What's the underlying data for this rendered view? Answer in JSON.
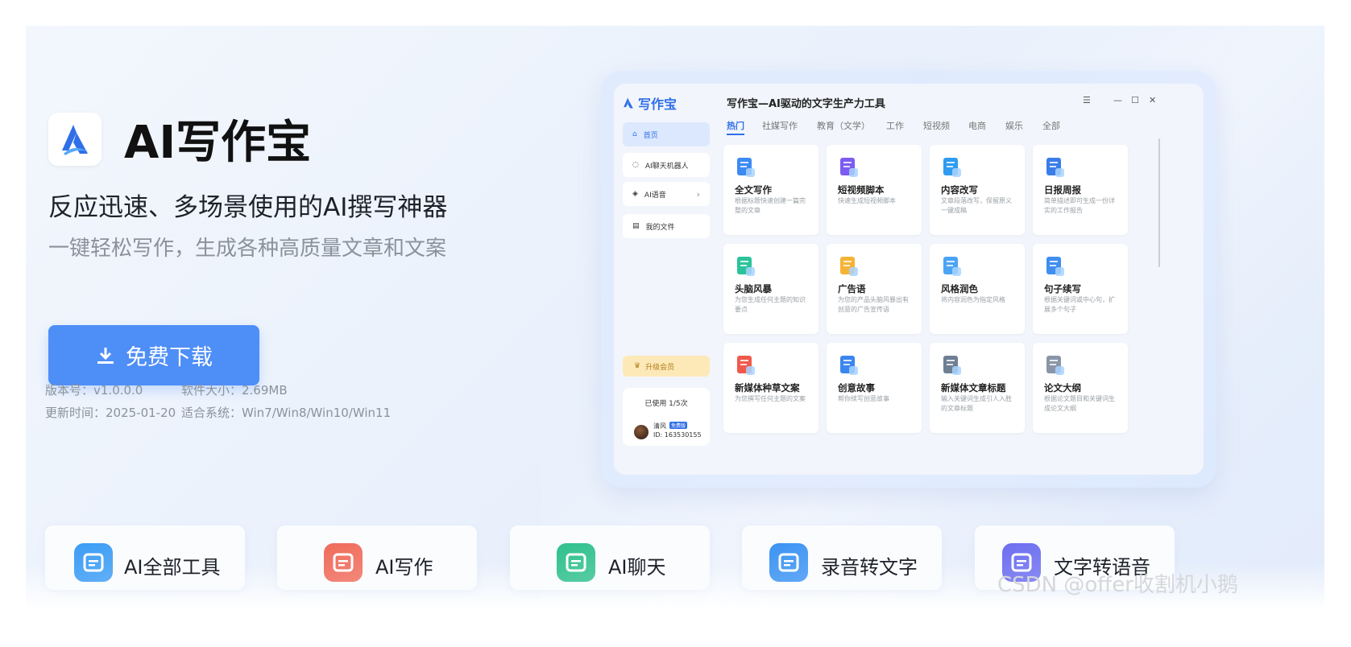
{
  "hero": {
    "title": "AI写作宝",
    "subtitle": "反应迅速、多场景使用的AI撰写神器",
    "description": "一键轻松写作，生成各种高质量文章和文案",
    "download_label": "免费下载",
    "version": "版本号：v1.0.0.0",
    "size": "软件大小：2.69MB",
    "updated": "更新时间：2025-01-20",
    "systems": "适合系统：Win7/Win8/Win10/Win11"
  },
  "app": {
    "brand": "写作宝",
    "window_title": "写作宝—AI驱动的文字生产力工具",
    "window_controls": [
      "☰",
      "—",
      "☐",
      "✕"
    ],
    "sidebar": [
      {
        "label": "首页",
        "icon": "home-icon"
      },
      {
        "label": "AI聊天机器人",
        "icon": "chat-icon"
      },
      {
        "label": "AI语音",
        "icon": "voice-icon"
      },
      {
        "label": "我的文件",
        "icon": "file-icon"
      }
    ],
    "upgrade_label": "升级会员",
    "usage": "已使用 1/5次",
    "user": {
      "name": "清风",
      "badge": "免费版",
      "id": "ID: 163530155"
    },
    "tabs": [
      "热门",
      "社媒写作",
      "教育（文学）",
      "工作",
      "短视频",
      "电商",
      "娱乐",
      "全部"
    ],
    "cards": [
      {
        "title": "全文写作",
        "desc": "根据标题快速创建一篇完整的文章",
        "color": "#3d8bf2"
      },
      {
        "title": "短视频脚本",
        "desc": "快速生成短视频脚本",
        "color": "#7c5cf2"
      },
      {
        "title": "内容改写",
        "desc": "文章段落改写，保留原义一键成稿",
        "color": "#2f9cf0"
      },
      {
        "title": "日报周报",
        "desc": "简单描述即可生成一份详实的工作报告",
        "color": "#3a7de8"
      },
      {
        "title": "头脑风暴",
        "desc": "为您生成任何主题的知识要点",
        "color": "#2bc49a"
      },
      {
        "title": "广告语",
        "desc": "为您的产品头脑风暴出有创意的广告宣传语",
        "color": "#f5b335"
      },
      {
        "title": "风格润色",
        "desc": "将内容润色为指定风格",
        "color": "#4aa3f5"
      },
      {
        "title": "句子续写",
        "desc": "根据关键词或中心句，扩展多个句子",
        "color": "#3f8ef0"
      },
      {
        "title": "新媒体种草文案",
        "desc": "为您撰写任何主题的文案",
        "color": "#ef5a4c"
      },
      {
        "title": "创意故事",
        "desc": "帮你续写创意故事",
        "color": "#3b86ef"
      },
      {
        "title": "新媒体文章标题",
        "desc": "输入关键词生成引人入胜的文章标题",
        "color": "#6e7f94"
      },
      {
        "title": "论文大纲",
        "desc": "根据论文题目和关键词生成论文大纲",
        "color": "#8a96a8"
      }
    ]
  },
  "tools": [
    {
      "label": "AI全部工具",
      "icon": "toolbox-icon",
      "color": "#3b9cf5"
    },
    {
      "label": "AI写作",
      "icon": "edit-icon",
      "color": "#f06b5a"
    },
    {
      "label": "AI聊天",
      "icon": "chat-bubble-icon",
      "color": "#2fc08d"
    },
    {
      "label": "录音转文字",
      "icon": "recording-icon",
      "color": "#3b93f3"
    },
    {
      "label": "文字转语音",
      "icon": "microphone-icon",
      "color": "#6c6ef0"
    }
  ],
  "watermark": "CSDN @offer收割机小鹅",
  "colors": {
    "accent": "#4e8ef7",
    "brand": "#2f6fe8",
    "background": "#eaf1fc"
  }
}
